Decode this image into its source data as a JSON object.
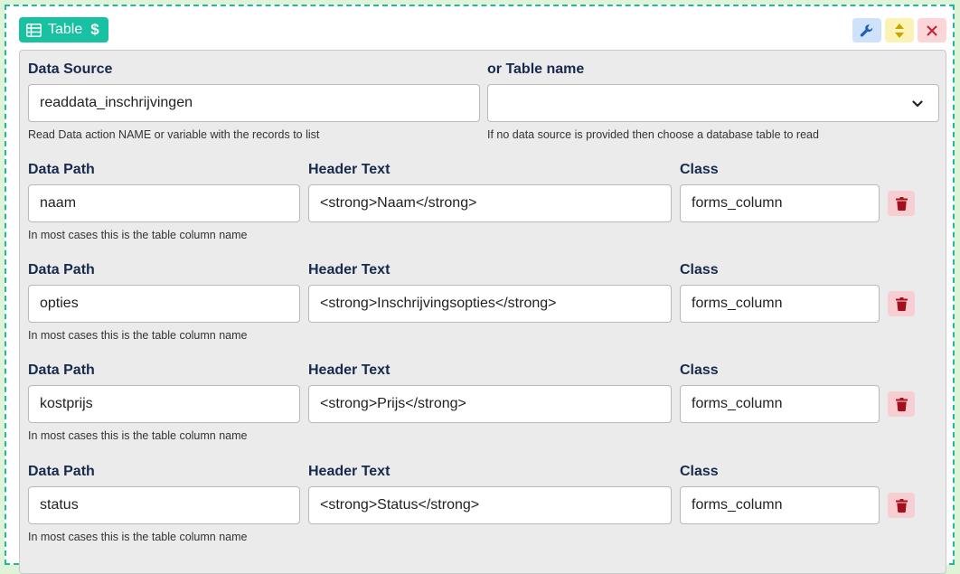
{
  "header": {
    "badge_label": "Table",
    "badge_icon": "table-icon",
    "dollar_symbol": "$",
    "tools": [
      "wrench-icon",
      "move-updown-icon",
      "close-icon"
    ]
  },
  "source": {
    "data_source_label": "Data Source",
    "data_source_value": "readdata_inschrijvingen",
    "data_source_help": "Read Data action NAME or variable with the records to list",
    "table_name_label": "or Table name",
    "table_name_value": "",
    "table_name_help": "If no data source is provided then choose a database table to read"
  },
  "columns": [
    {
      "path_label": "Data Path",
      "path_value": "naam",
      "header_label": "Header Text",
      "header_value": "<strong>Naam</strong>",
      "class_label": "Class",
      "class_value": "forms_column",
      "help": "In most cases this is the table column name"
    },
    {
      "path_label": "Data Path",
      "path_value": "opties",
      "header_label": "Header Text",
      "header_value": "<strong>Inschrijvingsopties</strong>",
      "class_label": "Class",
      "class_value": "forms_column",
      "help": "In most cases this is the table column name"
    },
    {
      "path_label": "Data Path",
      "path_value": "kostprijs",
      "header_label": "Header Text",
      "header_value": "<strong>Prijs</strong>",
      "class_label": "Class",
      "class_value": "forms_column",
      "help": "In most cases this is the table column name"
    },
    {
      "path_label": "Data Path",
      "path_value": "status",
      "header_label": "Header Text",
      "header_value": "<strong>Status</strong>",
      "class_label": "Class",
      "class_value": "forms_column",
      "help": "In most cases this is the table column name"
    }
  ],
  "colors": {
    "accent": "#17c1a2",
    "label": "#17294d",
    "delete": "#a3101d"
  }
}
